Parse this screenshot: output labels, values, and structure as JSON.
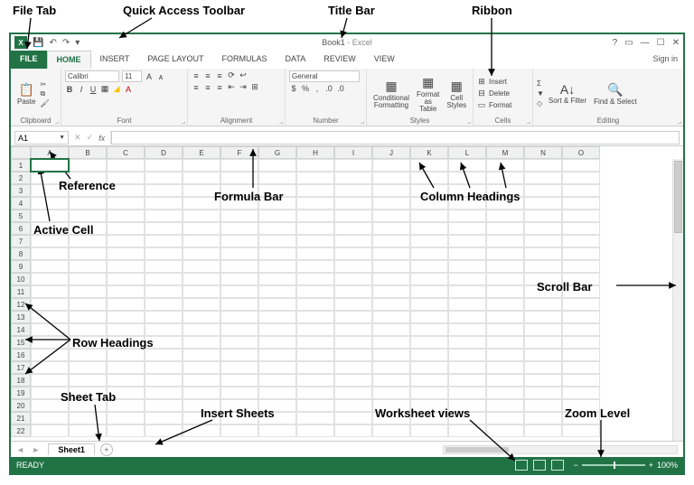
{
  "title": {
    "doc": "Book1",
    "app": "Excel"
  },
  "tabs": {
    "file": "FILE",
    "home": "HOME",
    "insert": "INSERT",
    "page_layout": "PAGE LAYOUT",
    "formulas": "FORMULAS",
    "data": "DATA",
    "review": "REVIEW",
    "view": "VIEW",
    "sign_in": "Sign in"
  },
  "ribbon": {
    "clipboard": {
      "label": "Clipboard",
      "paste": "Paste"
    },
    "font": {
      "label": "Font",
      "name": "Calibri",
      "size": "11"
    },
    "alignment": {
      "label": "Alignment"
    },
    "number": {
      "label": "Number",
      "format": "General"
    },
    "styles": {
      "label": "Styles",
      "cond": "Conditional\nFormatting",
      "table": "Format as\nTable",
      "cell": "Cell\nStyles"
    },
    "cells": {
      "label": "Cells",
      "insert": "Insert",
      "delete": "Delete",
      "format": "Format"
    },
    "editing": {
      "label": "Editing",
      "sort": "Sort &\nFilter",
      "find": "Find &\nSelect"
    }
  },
  "namebox": "A1",
  "columns": [
    "A",
    "B",
    "C",
    "D",
    "E",
    "F",
    "G",
    "H",
    "I",
    "J",
    "K",
    "L",
    "M",
    "N",
    "O"
  ],
  "rows": [
    "1",
    "2",
    "3",
    "4",
    "5",
    "6",
    "7",
    "8",
    "9",
    "10",
    "11",
    "12",
    "13",
    "14",
    "15",
    "16",
    "17",
    "18",
    "19",
    "20",
    "21",
    "22"
  ],
  "sheet": {
    "name": "Sheet1"
  },
  "status": {
    "ready": "READY",
    "zoom": "100%"
  },
  "annotations": {
    "file_tab": "File Tab",
    "qat": "Quick Access Toolbar",
    "title_bar": "Title Bar",
    "ribbon": "Ribbon",
    "reference": "Reference",
    "formula_bar": "Formula Bar",
    "column_headings": "Column Headings",
    "active_cell": "Active Cell",
    "scroll_bar": "Scroll Bar",
    "row_headings": "Row Headings",
    "sheet_tab": "Sheet Tab",
    "insert_sheets": "Insert Sheets",
    "worksheet_views": "Worksheet views",
    "zoom_level": "Zoom Level"
  }
}
